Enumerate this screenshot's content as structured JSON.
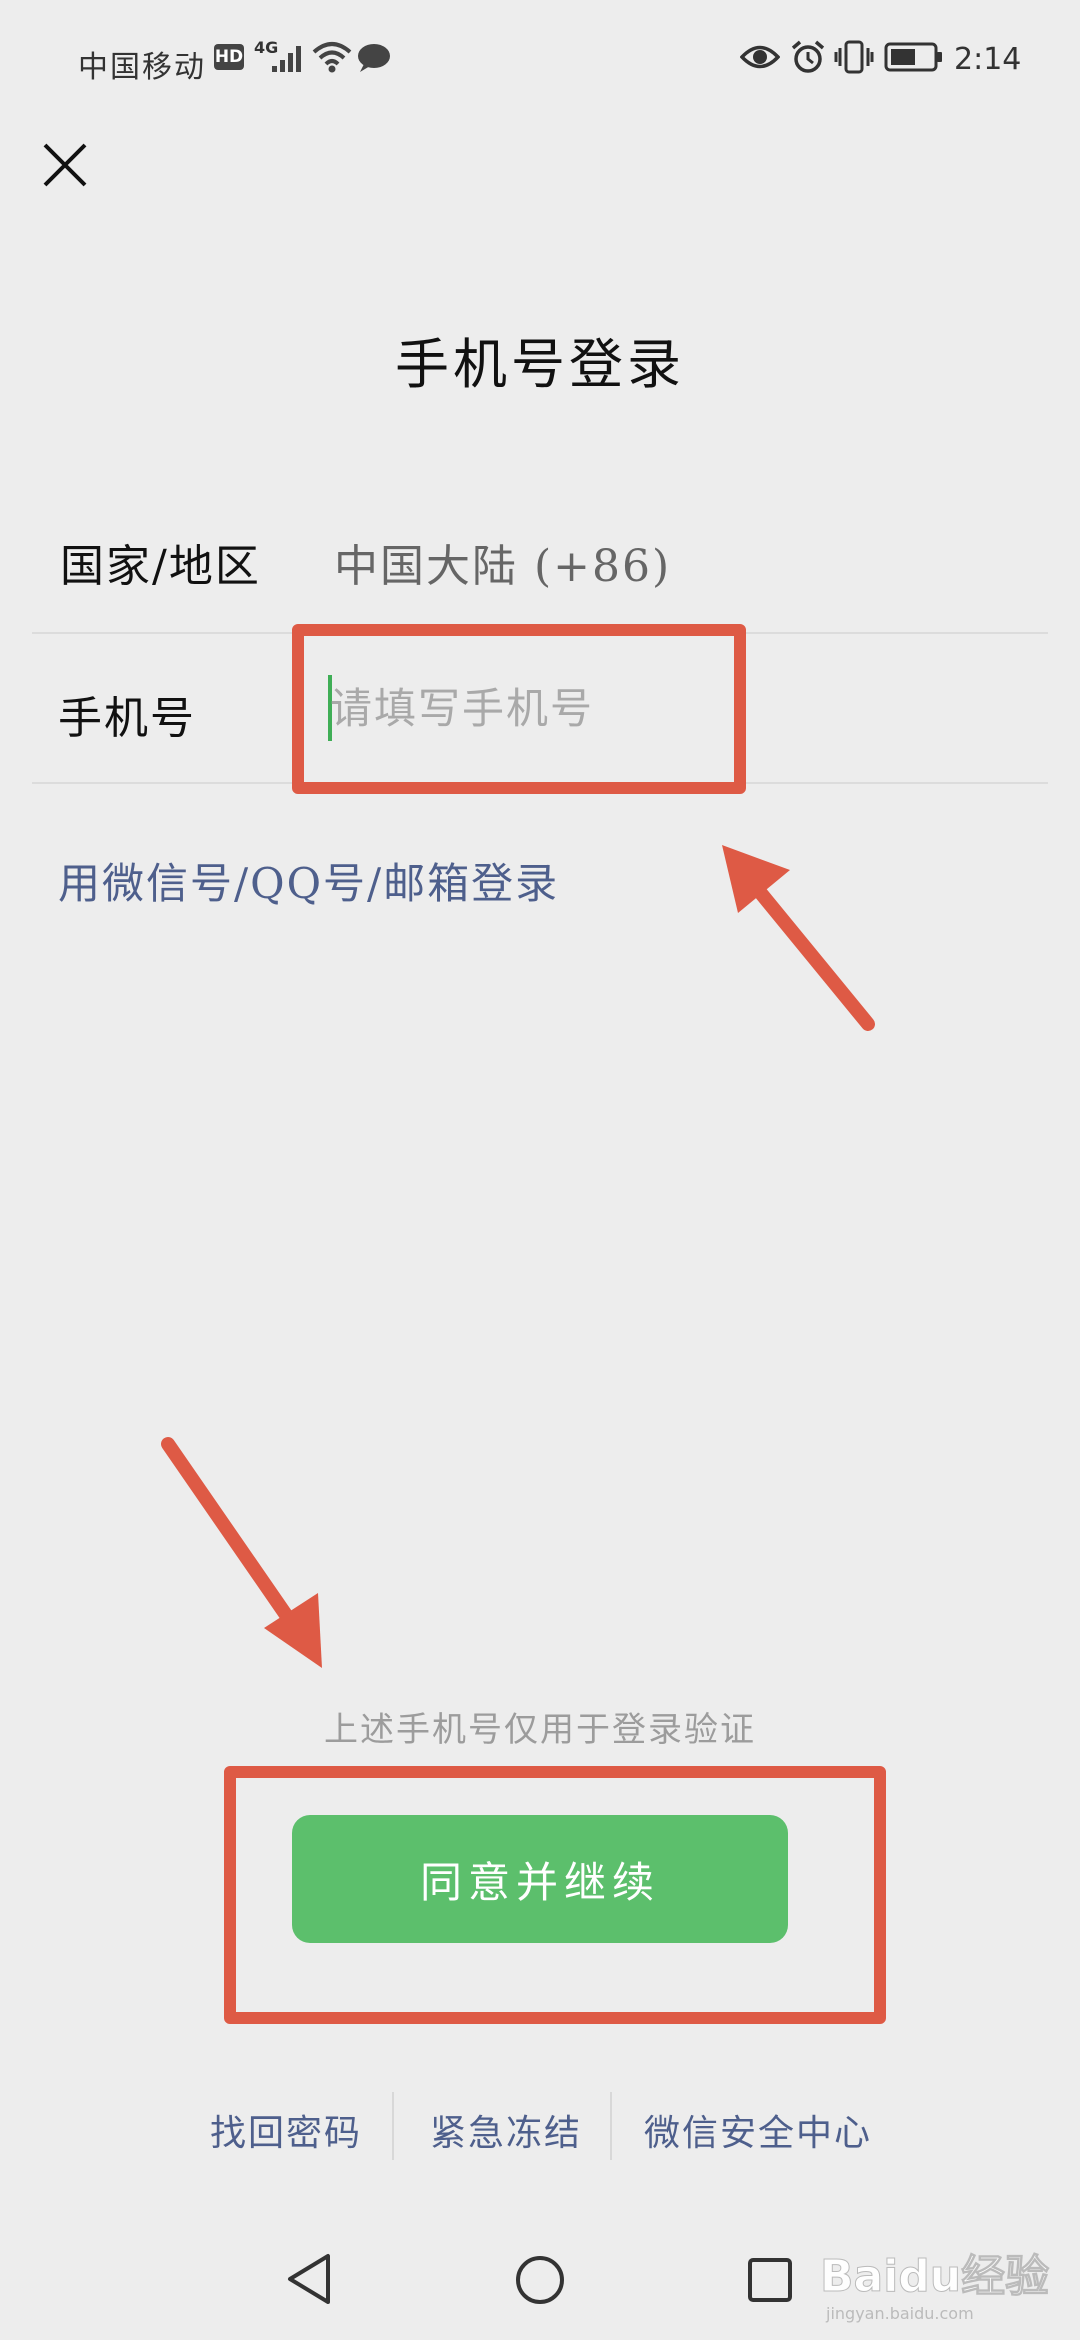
{
  "status_bar": {
    "carrier": "中国移动",
    "hd_badge": "HD",
    "network": "4G",
    "time": "2:14"
  },
  "icons": {
    "close": "close-icon",
    "eye": "eye-icon",
    "alarm": "alarm-icon",
    "vibrate": "vibrate-icon",
    "battery": "battery-icon",
    "wifi": "wifi-icon",
    "signal": "signal-icon",
    "message": "message-icon"
  },
  "page": {
    "title": "手机号登录"
  },
  "form": {
    "region_label": "国家/地区",
    "region_value": "中国大陆 (+86)",
    "phone_label": "手机号",
    "phone_placeholder": "请填写手机号",
    "phone_value": "",
    "alt_login_link": "用微信号/QQ号/邮箱登录"
  },
  "disclaimer": "上述手机号仅用于登录验证",
  "continue_button": "同意并继续",
  "footer": {
    "links": [
      "找回密码",
      "紧急冻结",
      "微信安全中心"
    ]
  },
  "watermark": {
    "brand": "Baidu经验",
    "url": "jingyan.baidu.com"
  },
  "colors": {
    "accent_green": "#5cbf6c",
    "link_blue": "#4e5f8c",
    "annotation_red": "#de5a45",
    "background": "#ededed"
  }
}
